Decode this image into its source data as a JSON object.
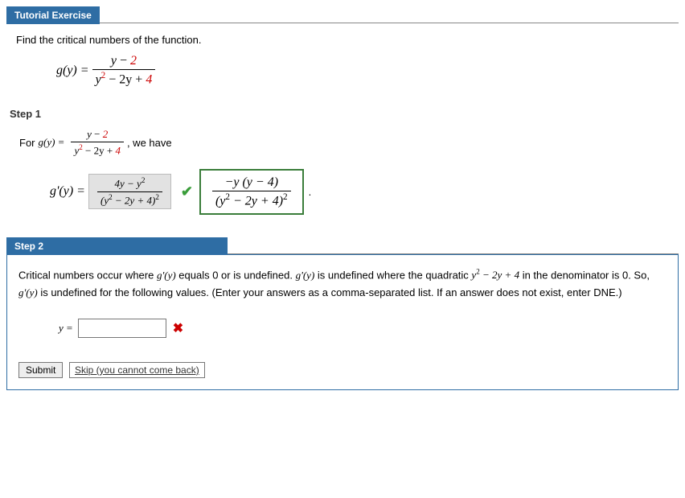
{
  "header": {
    "title": "Tutorial Exercise"
  },
  "prompt": "Find the critical numbers of the function.",
  "func": {
    "lhs": "g(y) =",
    "num_a": "y",
    "num_op": " − ",
    "num_b": "2",
    "den_a": "y",
    "den_exp": "2",
    "den_mid": " − 2y + ",
    "den_c": "4"
  },
  "step1": {
    "label": "Step 1",
    "pre": "For  ",
    "post": ",  we have",
    "deriv_lhs": "g'(y) =",
    "shade_num": "4y − y",
    "shade_num_exp": "2",
    "shade_den_inner": "y",
    "shade_den_inner_exp": "2",
    "shade_den_tail": " − 2y + 4",
    "shade_den_outer_exp": "2",
    "answer_num": "−y (y − 4)",
    "answer_den_inner": "(y",
    "answer_den_inner_exp": "2",
    "answer_den_tail": " − 2y + 4)",
    "answer_den_outer_exp": "2",
    "trailing": "."
  },
  "step2": {
    "label": "Step 2",
    "text_a": "Critical numbers occur where ",
    "gpy": "g'(y)",
    "text_b": " equals 0 or is undefined. ",
    "text_c": " is undefined where the quadratic ",
    "quad_a": "y",
    "quad_exp": "2",
    "quad_tail": " − 2y + ",
    "quad_c": "4",
    "text_d": " in the denominator is 0. So,  ",
    "text_e": "  is undefined for the following values. (Enter your answers as a comma-separated list. If an answer does not exist, enter DNE.)",
    "y_eq": "y =",
    "input_value": "",
    "submit": "Submit",
    "skip": "Skip (you cannot come back)"
  }
}
